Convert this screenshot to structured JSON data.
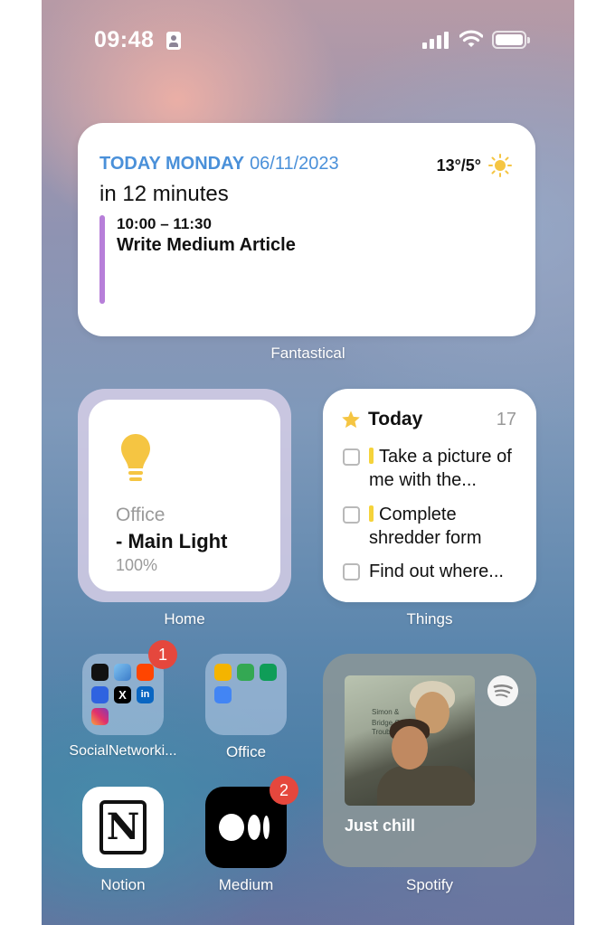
{
  "status": {
    "time": "09:48"
  },
  "fantastical": {
    "day_label": "TODAY MONDAY",
    "date": "06/11/2023",
    "weather": "13°/5°",
    "countdown": "in 12 minutes",
    "event_time": "10:00 – 11:30",
    "event_title": "Write Medium Article",
    "widget_label": "Fantastical"
  },
  "home": {
    "room": "Office",
    "device": "- Main Light",
    "level": "100%",
    "widget_label": "Home"
  },
  "things": {
    "heading": "Today",
    "count": "17",
    "items": [
      {
        "text": "Take a picture of me with the..."
      },
      {
        "text": "Complete shredder form"
      },
      {
        "text": "Find out where..."
      }
    ],
    "widget_label": "Things"
  },
  "folders": [
    {
      "label": "SocialNetworki...",
      "badge": "1"
    },
    {
      "label": "Office"
    }
  ],
  "apps": [
    {
      "label": "Notion"
    },
    {
      "label": "Medium",
      "badge": "2"
    }
  ],
  "spotify": {
    "playlist": "Just chill",
    "widget_label": "Spotify",
    "album_text": [
      "Simon &",
      "Bridge Over",
      "Troubled Water"
    ]
  },
  "colors": {
    "accent_blue": "#4a90d9",
    "event_bar": "#b77fd9",
    "badge_red": "#e5473d",
    "bulb_yellow": "#f5c542"
  }
}
